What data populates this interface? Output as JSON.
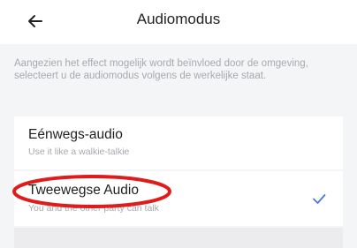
{
  "header": {
    "title": "Audiomodus"
  },
  "description": "Aangezien het effect mogelijk wordt beïnvloed door de omgeving, selecteert u de audiomodus volgens de werkelijke staat.",
  "options": [
    {
      "title": "Eénwegs-audio",
      "subtitle": "Use it like a walkie-talkie",
      "selected": false
    },
    {
      "title": "Tweewegse Audio",
      "subtitle": "You and the other party can talk",
      "selected": true
    }
  ],
  "colors": {
    "accent_check": "#4a79d8",
    "highlight_oval": "#e01b1b",
    "background": "#f4f5f7"
  },
  "icons": {
    "back": "arrow-left-icon",
    "check": "checkmark-icon"
  }
}
